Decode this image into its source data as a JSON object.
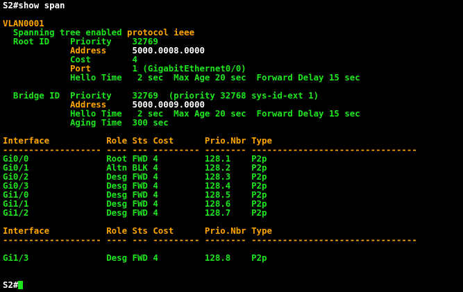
{
  "colors": {
    "background": "#000000",
    "text_green": "#1ee61e",
    "text_orange": "#ffa500",
    "text_white": "#ffffff"
  },
  "terminal": {
    "command_prompt": "S2#show span",
    "vlan": "VLAN0001",
    "stp_prefix": "  Spanning tree enabled ",
    "stp_protocol": "protocol ieee",
    "root": {
      "priority_line": "  Root ID    Priority    32769",
      "address_label": "             Address     ",
      "address_value": "5000.0008.0000",
      "cost_line": "             Cost        4",
      "port_label": "             Port        ",
      "port_value": "1 (GigabitEthernet0/0)",
      "hello_line": "             Hello Time   2 sec  Max Age 20 sec  Forward Delay 15 sec"
    },
    "bridge": {
      "priority_line": "  Bridge ID  Priority    32769  (priority 32768 sys-id-ext 1)",
      "address_label": "             Address     ",
      "address_value": "5000.0009.0000",
      "hello_line": "             Hello Time   2 sec  Max Age 20 sec  Forward Delay 15 sec",
      "aging_line": "             Aging Time  300 sec"
    },
    "table_header": "Interface           Role Sts Cost      Prio.Nbr Type",
    "table_separator": "------------------- ---- --- --------- -------- --------------------------------",
    "rows": [
      "Gi0/0               Root FWD 4         128.1    P2p",
      "Gi0/1               Altn BLK 4         128.2    P2p",
      "Gi0/2               Desg FWD 4         128.3    P2p",
      "Gi0/3               Desg FWD 4         128.4    P2p",
      "Gi1/0               Desg FWD 4         128.5    P2p",
      "Gi1/1               Desg FWD 4         128.6    P2p",
      "Gi1/2               Desg FWD 4         128.7    P2p"
    ],
    "table2_header": "Interface           Role Sts Cost      Prio.Nbr Type",
    "table2_separator": "------------------- ---- --- --------- -------- --------------------------------",
    "table2_rows": [
      "Gi1/3               Desg FWD 4         128.8    P2p"
    ],
    "final_prompt": "S2#"
  }
}
